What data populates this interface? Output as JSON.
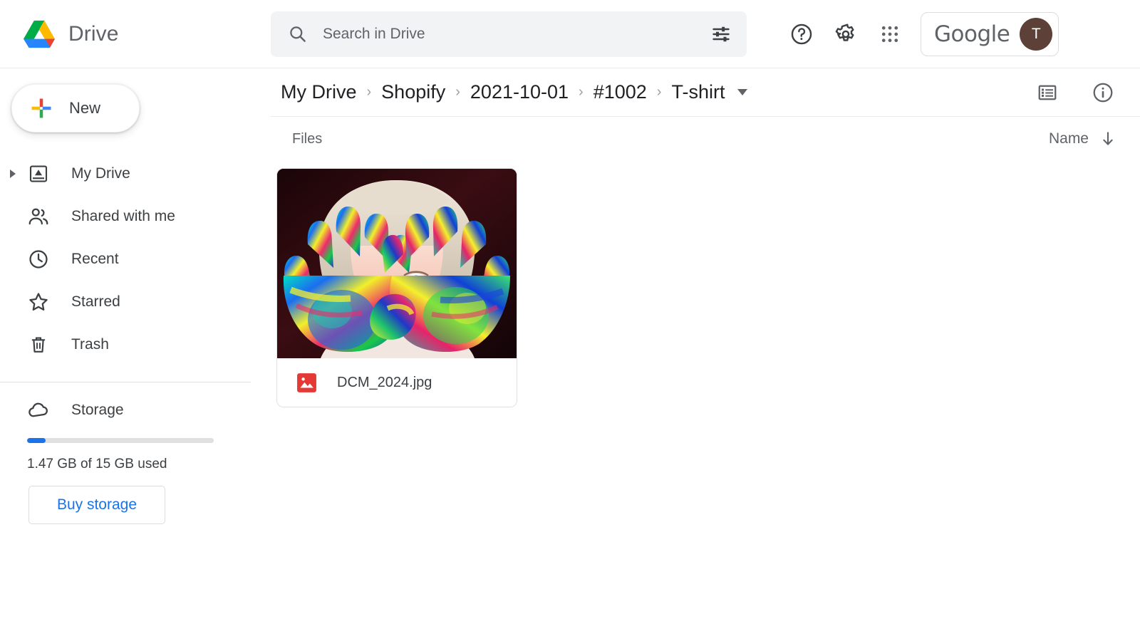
{
  "app": {
    "name": "Drive",
    "logo_icon": "drive-logo"
  },
  "search": {
    "placeholder": "Search in Drive",
    "value": "",
    "search_icon": "search-icon",
    "filter_icon": "tune-filter-icon"
  },
  "header": {
    "help_icon": "help-circle-icon",
    "settings_icon": "gear-icon",
    "apps_icon": "apps-grid-icon",
    "account_label": "Google",
    "avatar_initial": "T",
    "avatar_color": "#5d4037"
  },
  "sidebar": {
    "new_button": {
      "label": "New",
      "icon": "plus-icon"
    },
    "items": [
      {
        "label": "My Drive",
        "icon": "my-drive-icon",
        "expandable": true
      },
      {
        "label": "Shared with me",
        "icon": "people-icon",
        "expandable": false
      },
      {
        "label": "Recent",
        "icon": "clock-icon",
        "expandable": false
      },
      {
        "label": "Starred",
        "icon": "star-icon",
        "expandable": false
      },
      {
        "label": "Trash",
        "icon": "trash-icon",
        "expandable": false
      }
    ],
    "storage": {
      "label": "Storage",
      "icon": "cloud-icon",
      "used_text": "1.47 GB of 15 GB used",
      "percent_used": 9.8,
      "bar_color": "#1a73e8",
      "buy_button": "Buy storage",
      "buy_button_color": "#1a73e8"
    }
  },
  "breadcrumb": {
    "items": [
      "My Drive",
      "Shopify",
      "2021-10-01",
      "#1002",
      "T-shirt"
    ],
    "separator": "›",
    "dropdown_icon": "chevron-down-icon",
    "list_view_icon": "list-view-icon",
    "info_icon": "info-circle-icon"
  },
  "files_section": {
    "title": "Files",
    "sort_label": "Name",
    "sort_direction_icon": "arrow-down-icon",
    "files": [
      {
        "name": "DCM_2024.jpg",
        "type_icon": "image-file-icon",
        "type_icon_color": "#e53935",
        "thumbnail_alt": "child with paint covered hands over face"
      }
    ]
  }
}
